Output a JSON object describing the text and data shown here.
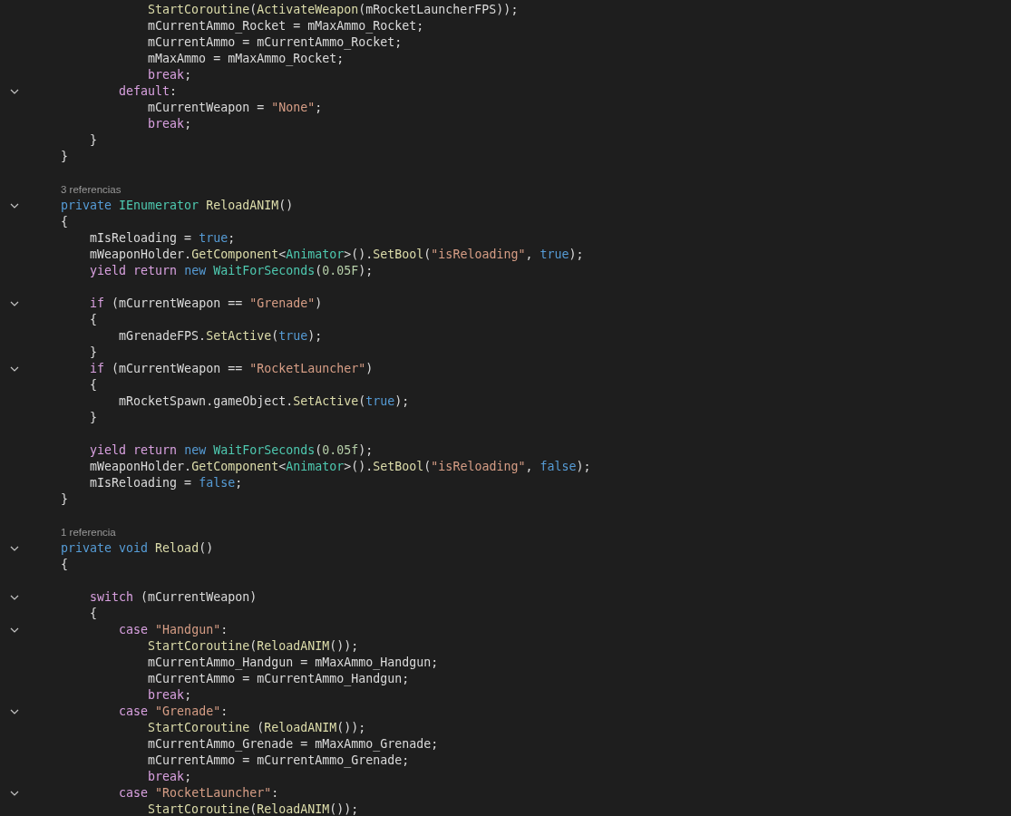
{
  "lines": [
    {
      "tokens": [
        {
          "kind": "method",
          "text": "                StartCoroutine"
        },
        {
          "kind": "plain",
          "text": "("
        },
        {
          "kind": "method",
          "text": "ActivateWeapon"
        },
        {
          "kind": "plain",
          "text": "(mRocketLauncherFPS));"
        }
      ]
    },
    {
      "tokens": [
        {
          "kind": "plain",
          "text": "                mCurrentAmmo_Rocket = mMaxAmmo_Rocket;"
        }
      ]
    },
    {
      "tokens": [
        {
          "kind": "plain",
          "text": "                mCurrentAmmo = mCurrentAmmo_Rocket;"
        }
      ]
    },
    {
      "tokens": [
        {
          "kind": "plain",
          "text": "                mMaxAmmo = mMaxAmmo_Rocket;"
        }
      ]
    },
    {
      "tokens": [
        {
          "kind": "control",
          "text": "                break"
        },
        {
          "kind": "plain",
          "text": ";"
        }
      ]
    },
    {
      "expanded": true,
      "tokens": [
        {
          "kind": "control",
          "text": "            default"
        },
        {
          "kind": "plain",
          "text": ":"
        }
      ]
    },
    {
      "tokens": [
        {
          "kind": "plain",
          "text": "                mCurrentWeapon = "
        },
        {
          "kind": "string",
          "text": "\"None\""
        },
        {
          "kind": "plain",
          "text": ";"
        }
      ]
    },
    {
      "tokens": [
        {
          "kind": "control",
          "text": "                break"
        },
        {
          "kind": "plain",
          "text": ";"
        }
      ]
    },
    {
      "tokens": [
        {
          "kind": "plain",
          "text": "        }"
        }
      ]
    },
    {
      "tokens": [
        {
          "kind": "plain",
          "text": "    }"
        }
      ]
    },
    {
      "blank_before": true,
      "reference_count": "3 referencias",
      "expanded": true,
      "tokens": [
        {
          "kind": "keyword",
          "text": "    private"
        },
        {
          "kind": "type",
          "text": " IEnumerator"
        },
        {
          "kind": "method",
          "text": " ReloadANIM"
        },
        {
          "kind": "plain",
          "text": "()"
        }
      ]
    },
    {
      "tokens": [
        {
          "kind": "plain",
          "text": "    {"
        }
      ]
    },
    {
      "tokens": [
        {
          "kind": "plain",
          "text": "        mIsReloading = "
        },
        {
          "kind": "keyword",
          "text": "true"
        },
        {
          "kind": "plain",
          "text": ";"
        }
      ]
    },
    {
      "tokens": [
        {
          "kind": "plain",
          "text": "        mWeaponHolder."
        },
        {
          "kind": "method",
          "text": "GetComponent"
        },
        {
          "kind": "plain",
          "text": "<"
        },
        {
          "kind": "type",
          "text": "Animator"
        },
        {
          "kind": "plain",
          "text": ">()."
        },
        {
          "kind": "method",
          "text": "SetBool"
        },
        {
          "kind": "plain",
          "text": "("
        },
        {
          "kind": "string",
          "text": "\"isReloading\""
        },
        {
          "kind": "plain",
          "text": ","
        },
        {
          "kind": "keyword",
          "text": " true"
        },
        {
          "kind": "plain",
          "text": ");"
        }
      ]
    },
    {
      "tokens": [
        {
          "kind": "control",
          "text": "        yield"
        },
        {
          "kind": "control",
          "text": " return"
        },
        {
          "kind": "keyword",
          "text": " new"
        },
        {
          "kind": "type",
          "text": " WaitForSeconds"
        },
        {
          "kind": "plain",
          "text": "("
        },
        {
          "kind": "number",
          "text": "0.05F"
        },
        {
          "kind": "plain",
          "text": ");"
        }
      ]
    },
    {
      "blank_before": true,
      "expanded": true,
      "tokens": [
        {
          "kind": "control",
          "text": "        if"
        },
        {
          "kind": "plain",
          "text": " (mCurrentWeapon == "
        },
        {
          "kind": "string",
          "text": "\"Grenade\""
        },
        {
          "kind": "plain",
          "text": ")"
        }
      ]
    },
    {
      "tokens": [
        {
          "kind": "plain",
          "text": "        {"
        }
      ]
    },
    {
      "tokens": [
        {
          "kind": "plain",
          "text": "            mGrenadeFPS."
        },
        {
          "kind": "method",
          "text": "SetActive"
        },
        {
          "kind": "plain",
          "text": "("
        },
        {
          "kind": "keyword",
          "text": "true"
        },
        {
          "kind": "plain",
          "text": ");"
        }
      ]
    },
    {
      "tokens": [
        {
          "kind": "plain",
          "text": "        }"
        }
      ]
    },
    {
      "expanded": true,
      "tokens": [
        {
          "kind": "control",
          "text": "        if"
        },
        {
          "kind": "plain",
          "text": " (mCurrentWeapon == "
        },
        {
          "kind": "string",
          "text": "\"RocketLauncher\""
        },
        {
          "kind": "plain",
          "text": ")"
        }
      ]
    },
    {
      "tokens": [
        {
          "kind": "plain",
          "text": "        {"
        }
      ]
    },
    {
      "tokens": [
        {
          "kind": "plain",
          "text": "            mRocketSpawn.gameObject."
        },
        {
          "kind": "method",
          "text": "SetActive"
        },
        {
          "kind": "plain",
          "text": "("
        },
        {
          "kind": "keyword",
          "text": "true"
        },
        {
          "kind": "plain",
          "text": ");"
        }
      ]
    },
    {
      "tokens": [
        {
          "kind": "plain",
          "text": "        }"
        }
      ]
    },
    {
      "blank_before": true,
      "tokens": [
        {
          "kind": "control",
          "text": "        yield"
        },
        {
          "kind": "control",
          "text": " return"
        },
        {
          "kind": "keyword",
          "text": " new"
        },
        {
          "kind": "type",
          "text": " WaitForSeconds"
        },
        {
          "kind": "plain",
          "text": "("
        },
        {
          "kind": "number",
          "text": "0.05f"
        },
        {
          "kind": "plain",
          "text": ");"
        }
      ]
    },
    {
      "tokens": [
        {
          "kind": "plain",
          "text": "        mWeaponHolder."
        },
        {
          "kind": "method",
          "text": "GetComponent"
        },
        {
          "kind": "plain",
          "text": "<"
        },
        {
          "kind": "type",
          "text": "Animator"
        },
        {
          "kind": "plain",
          "text": ">()."
        },
        {
          "kind": "method",
          "text": "SetBool"
        },
        {
          "kind": "plain",
          "text": "("
        },
        {
          "kind": "string",
          "text": "\"isReloading\""
        },
        {
          "kind": "plain",
          "text": ","
        },
        {
          "kind": "keyword",
          "text": " false"
        },
        {
          "kind": "plain",
          "text": ");"
        }
      ]
    },
    {
      "tokens": [
        {
          "kind": "plain",
          "text": "        mIsReloading = "
        },
        {
          "kind": "keyword",
          "text": "false"
        },
        {
          "kind": "plain",
          "text": ";"
        }
      ]
    },
    {
      "tokens": [
        {
          "kind": "plain",
          "text": "    }"
        }
      ]
    },
    {
      "blank_before": true,
      "reference_count": "1 referencia",
      "expanded": true,
      "tokens": [
        {
          "kind": "keyword",
          "text": "    private"
        },
        {
          "kind": "keyword",
          "text": " void"
        },
        {
          "kind": "method",
          "text": " Reload"
        },
        {
          "kind": "plain",
          "text": "()"
        }
      ]
    },
    {
      "tokens": [
        {
          "kind": "plain",
          "text": "    {"
        }
      ]
    },
    {
      "blank_before": true,
      "expanded": true,
      "tokens": [
        {
          "kind": "control",
          "text": "        switch"
        },
        {
          "kind": "plain",
          "text": " (mCurrentWeapon)"
        }
      ]
    },
    {
      "tokens": [
        {
          "kind": "plain",
          "text": "        {"
        }
      ]
    },
    {
      "expanded": true,
      "tokens": [
        {
          "kind": "control",
          "text": "            case"
        },
        {
          "kind": "string",
          "text": " \"Handgun\""
        },
        {
          "kind": "plain",
          "text": ":"
        }
      ]
    },
    {
      "tokens": [
        {
          "kind": "method",
          "text": "                StartCoroutine"
        },
        {
          "kind": "plain",
          "text": "("
        },
        {
          "kind": "method",
          "text": "ReloadANIM"
        },
        {
          "kind": "plain",
          "text": "());"
        }
      ]
    },
    {
      "tokens": [
        {
          "kind": "plain",
          "text": "                mCurrentAmmo_Handgun = mMaxAmmo_Handgun;"
        }
      ]
    },
    {
      "tokens": [
        {
          "kind": "plain",
          "text": "                mCurrentAmmo = mCurrentAmmo_Handgun;"
        }
      ]
    },
    {
      "tokens": [
        {
          "kind": "control",
          "text": "                break"
        },
        {
          "kind": "plain",
          "text": ";"
        }
      ]
    },
    {
      "expanded": true,
      "tokens": [
        {
          "kind": "control",
          "text": "            case"
        },
        {
          "kind": "string",
          "text": " \"Grenade\""
        },
        {
          "kind": "plain",
          "text": ":"
        }
      ]
    },
    {
      "tokens": [
        {
          "kind": "method",
          "text": "                StartCoroutine"
        },
        {
          "kind": "plain",
          "text": " ("
        },
        {
          "kind": "method",
          "text": "ReloadANIM"
        },
        {
          "kind": "plain",
          "text": "());"
        }
      ]
    },
    {
      "tokens": [
        {
          "kind": "plain",
          "text": "                mCurrentAmmo_Grenade = mMaxAmmo_Grenade;"
        }
      ]
    },
    {
      "tokens": [
        {
          "kind": "plain",
          "text": "                mCurrentAmmo = mCurrentAmmo_Grenade;"
        }
      ]
    },
    {
      "tokens": [
        {
          "kind": "control",
          "text": "                break"
        },
        {
          "kind": "plain",
          "text": ";"
        }
      ]
    },
    {
      "expanded": true,
      "tokens": [
        {
          "kind": "control",
          "text": "            case"
        },
        {
          "kind": "string",
          "text": " \"RocketLauncher\""
        },
        {
          "kind": "plain",
          "text": ":"
        }
      ]
    },
    {
      "tokens": [
        {
          "kind": "method",
          "text": "                StartCoroutine"
        },
        {
          "kind": "plain",
          "text": "("
        },
        {
          "kind": "method",
          "text": "ReloadANIM"
        },
        {
          "kind": "plain",
          "text": "());"
        }
      ]
    }
  ]
}
